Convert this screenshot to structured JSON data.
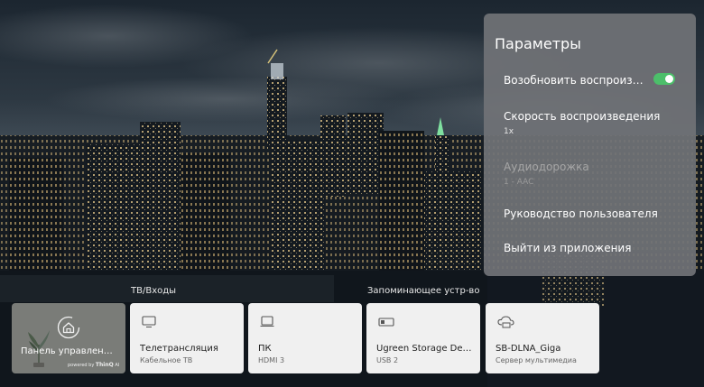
{
  "settings_panel": {
    "title": "Параметры",
    "options": [
      {
        "label": "Возобновить воспроизве…",
        "toggle_on": true
      },
      {
        "label": "Скорость воспроизведения",
        "value": "1x"
      },
      {
        "label": "Аудиодорожка",
        "value": "1 - AAC",
        "disabled": true
      },
      {
        "label": "Руководство пользователя"
      },
      {
        "label": "Выйти из приложения"
      }
    ],
    "toggle_color": "#4cbf6a"
  },
  "launcher": {
    "section_inputs": "ТВ/Входы",
    "section_storage": "Запоминающее устр-во",
    "cards": [
      {
        "title": "Панель управлен…",
        "badge_prefix": "powered by",
        "badge_brand": "ThinQ",
        "badge_suffix": "AI",
        "icon": "home-icon"
      },
      {
        "title": "Телетрансляция",
        "subtitle": "Кабельное ТВ",
        "icon": "tv-icon"
      },
      {
        "title": "ПК",
        "subtitle": "HDMI 3",
        "icon": "monitor-icon"
      },
      {
        "title": "Ugreen Storage Dev…",
        "subtitle": "USB 2",
        "icon": "usb-storage-icon"
      },
      {
        "title": "SB-DLNA_Giga",
        "subtitle": "Сервер мультимедиа",
        "icon": "media-server-icon"
      }
    ]
  }
}
